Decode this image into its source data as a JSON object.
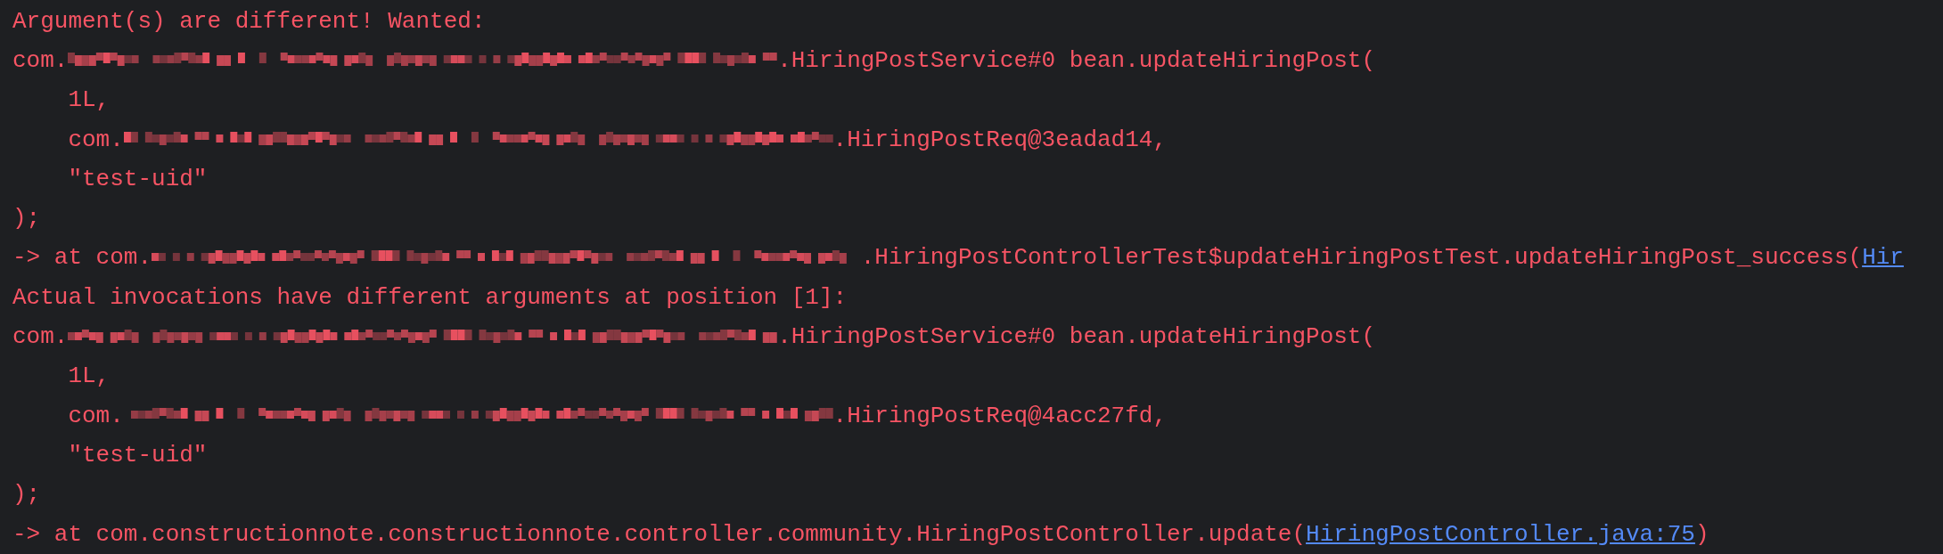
{
  "console": {
    "lines": [
      {
        "segments": [
          {
            "kind": "text",
            "text": "Argument(s) are different! Wanted:"
          }
        ]
      },
      {
        "segments": [
          {
            "kind": "text",
            "text": "com."
          },
          {
            "kind": "redacted"
          },
          {
            "kind": "text",
            "text": ".HiringPostService#0 bean.updateHiringPost("
          }
        ]
      },
      {
        "segments": [
          {
            "kind": "text",
            "text": "    1L,"
          }
        ]
      },
      {
        "segments": [
          {
            "kind": "text",
            "text": "    com."
          },
          {
            "kind": "redacted"
          },
          {
            "kind": "text",
            "text": ".HiringPostReq@3eadad14,"
          }
        ]
      },
      {
        "segments": [
          {
            "kind": "text",
            "text": "    \"test-uid\""
          }
        ]
      },
      {
        "segments": [
          {
            "kind": "text",
            "text": ");"
          }
        ]
      },
      {
        "segments": [
          {
            "kind": "text",
            "text": "-> at com."
          },
          {
            "kind": "redacted"
          },
          {
            "kind": "text",
            "text": ".HiringPostControllerTest$updateHiringPostTest.updateHiringPost_success("
          },
          {
            "kind": "link",
            "text": "Hir"
          }
        ]
      },
      {
        "segments": [
          {
            "kind": "text",
            "text": "Actual invocations have different arguments at position [1]:"
          }
        ]
      },
      {
        "segments": [
          {
            "kind": "text",
            "text": "com."
          },
          {
            "kind": "redacted"
          },
          {
            "kind": "text",
            "text": ".HiringPostService#0 bean.updateHiringPost("
          }
        ]
      },
      {
        "segments": [
          {
            "kind": "text",
            "text": "    1L,"
          }
        ]
      },
      {
        "segments": [
          {
            "kind": "text",
            "text": "    com."
          },
          {
            "kind": "redacted"
          },
          {
            "kind": "text",
            "text": ".HiringPostReq@4acc27fd,"
          }
        ]
      },
      {
        "segments": [
          {
            "kind": "text",
            "text": "    \"test-uid\""
          }
        ]
      },
      {
        "segments": [
          {
            "kind": "text",
            "text": ");"
          }
        ]
      },
      {
        "segments": [
          {
            "kind": "text",
            "text": "-> at com.constructionnote.constructionnote.controller.community.HiringPostController.update("
          },
          {
            "kind": "link",
            "text": "HiringPostController.java:75"
          },
          {
            "kind": "text",
            "text": ")"
          }
        ]
      }
    ]
  }
}
